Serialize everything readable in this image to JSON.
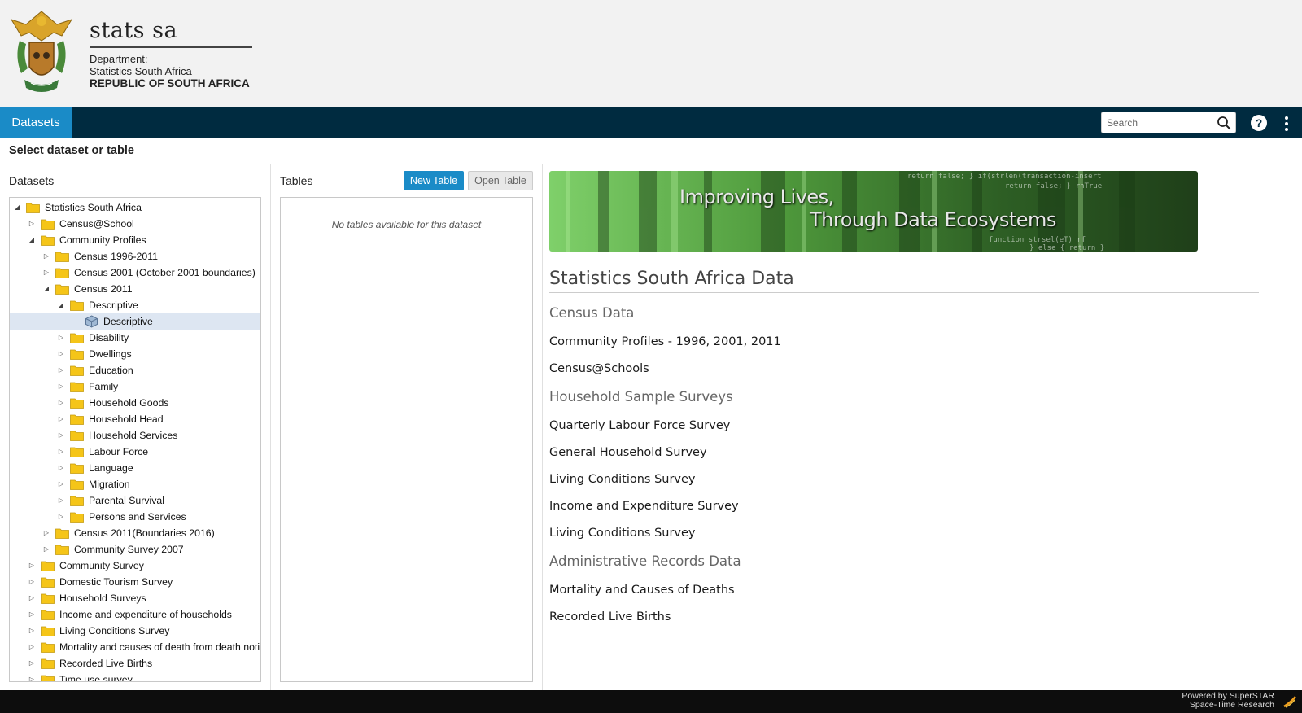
{
  "header": {
    "brand_name": "stats sa",
    "dept_line1": "Department:",
    "dept_line2": "Statistics South Africa",
    "dept_line3": "REPUBLIC OF SOUTH AFRICA"
  },
  "navbar": {
    "active_tab": "Datasets",
    "search_placeholder": "Search",
    "help_symbol": "?"
  },
  "page": {
    "heading": "Select dataset or table"
  },
  "datasets": {
    "title": "Datasets",
    "tree": [
      {
        "label": "Statistics South Africa",
        "level": 0,
        "state": "expanded",
        "icon": "folder-icon"
      },
      {
        "label": "Census@School",
        "level": 1,
        "state": "collapsed",
        "icon": "folder-icon"
      },
      {
        "label": "Community Profiles",
        "level": 1,
        "state": "expanded",
        "icon": "folder-icon"
      },
      {
        "label": "Census 1996-2011",
        "level": 2,
        "state": "collapsed",
        "icon": "folder-icon"
      },
      {
        "label": "Census 2001 (October 2001 boundaries)",
        "level": 2,
        "state": "collapsed",
        "icon": "folder-icon"
      },
      {
        "label": "Census 2011",
        "level": 2,
        "state": "expanded",
        "icon": "folder-icon"
      },
      {
        "label": "Descriptive",
        "level": 3,
        "state": "expanded",
        "icon": "folder-icon"
      },
      {
        "label": "Descriptive",
        "level": 4,
        "state": "leaf",
        "icon": "cube-icon",
        "selected": true
      },
      {
        "label": "Disability",
        "level": 3,
        "state": "collapsed",
        "icon": "folder-icon"
      },
      {
        "label": "Dwellings",
        "level": 3,
        "state": "collapsed",
        "icon": "folder-icon"
      },
      {
        "label": "Education",
        "level": 3,
        "state": "collapsed",
        "icon": "folder-icon"
      },
      {
        "label": "Family",
        "level": 3,
        "state": "collapsed",
        "icon": "folder-icon"
      },
      {
        "label": "Household Goods",
        "level": 3,
        "state": "collapsed",
        "icon": "folder-icon"
      },
      {
        "label": "Household Head",
        "level": 3,
        "state": "collapsed",
        "icon": "folder-icon"
      },
      {
        "label": "Household Services",
        "level": 3,
        "state": "collapsed",
        "icon": "folder-icon"
      },
      {
        "label": "Labour Force",
        "level": 3,
        "state": "collapsed",
        "icon": "folder-icon"
      },
      {
        "label": "Language",
        "level": 3,
        "state": "collapsed",
        "icon": "folder-icon"
      },
      {
        "label": "Migration",
        "level": 3,
        "state": "collapsed",
        "icon": "folder-icon"
      },
      {
        "label": "Parental Survival",
        "level": 3,
        "state": "collapsed",
        "icon": "folder-icon"
      },
      {
        "label": "Persons and Services",
        "level": 3,
        "state": "collapsed",
        "icon": "folder-icon"
      },
      {
        "label": "Census 2011(Boundaries 2016)",
        "level": 2,
        "state": "collapsed",
        "icon": "folder-icon"
      },
      {
        "label": "Community Survey 2007",
        "level": 2,
        "state": "collapsed",
        "icon": "folder-icon"
      },
      {
        "label": "Community Survey",
        "level": 1,
        "state": "collapsed",
        "icon": "folder-icon"
      },
      {
        "label": "Domestic Tourism Survey",
        "level": 1,
        "state": "collapsed",
        "icon": "folder-icon"
      },
      {
        "label": "Household Surveys",
        "level": 1,
        "state": "collapsed",
        "icon": "folder-icon"
      },
      {
        "label": "Income and expenditure of households",
        "level": 1,
        "state": "collapsed",
        "icon": "folder-icon"
      },
      {
        "label": "Living Conditions Survey",
        "level": 1,
        "state": "collapsed",
        "icon": "folder-icon"
      },
      {
        "label": "Mortality and causes of death from death notif",
        "level": 1,
        "state": "collapsed",
        "icon": "folder-icon"
      },
      {
        "label": "Recorded Live Births",
        "level": 1,
        "state": "collapsed",
        "icon": "folder-icon"
      },
      {
        "label": "Time use survey",
        "level": 1,
        "state": "collapsed",
        "icon": "folder-icon"
      }
    ]
  },
  "tables": {
    "title": "Tables",
    "new_table_label": "New Table",
    "open_table_label": "Open Table",
    "empty_message": "No tables available for this dataset"
  },
  "banner": {
    "line1": "Improving Lives,",
    "line2": "Through Data Ecosystems"
  },
  "content": {
    "title": "Statistics South Africa Data",
    "sections": [
      {
        "heading": "Census Data",
        "links": [
          "Community Profiles - 1996, 2001, 2011",
          "Census@Schools"
        ]
      },
      {
        "heading": "Household Sample Surveys",
        "links": [
          "Quarterly Labour Force Survey",
          "General Household Survey",
          "Living Conditions Survey",
          "Income and Expenditure Survey",
          "Living Conditions Survey"
        ]
      },
      {
        "heading": "Administrative Records Data",
        "links": [
          "Mortality and Causes of Deaths",
          "Recorded Live Births"
        ]
      }
    ]
  },
  "footer": {
    "powered_line1": "Powered by SuperSTAR",
    "powered_line2": "Space-Time Research"
  },
  "colors": {
    "accent_blue": "#1a8bc7",
    "navbar_bg": "#002b40",
    "footer_bg": "#0d0d0d",
    "folder_yellow": "#f5c518",
    "selected_row": "#dde6f2"
  }
}
